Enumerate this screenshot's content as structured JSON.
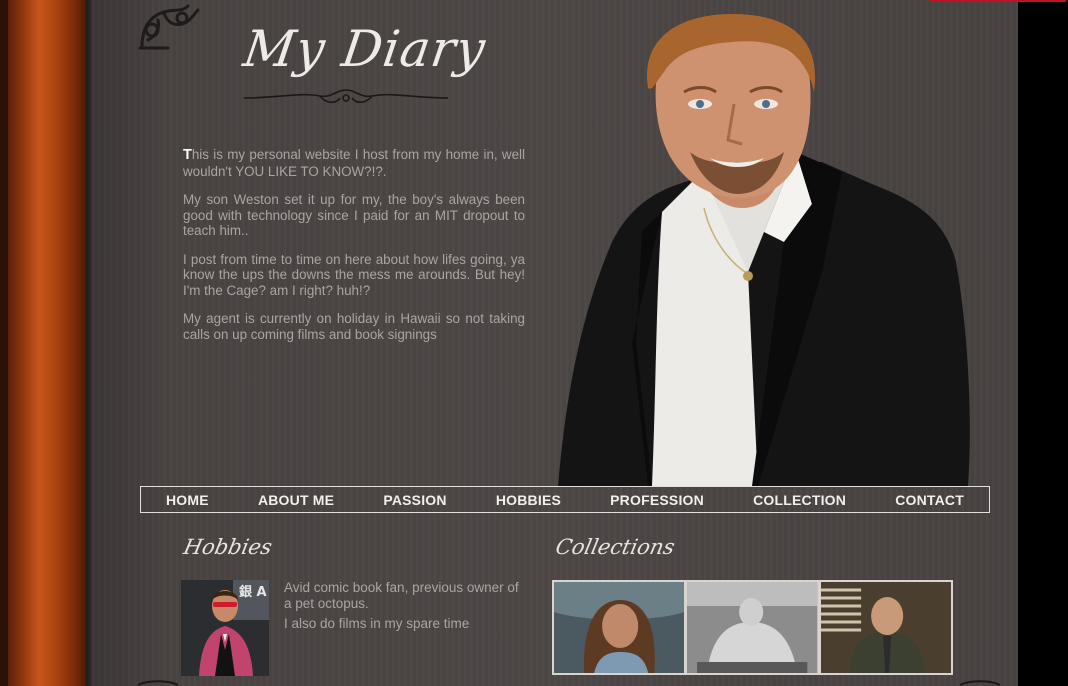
{
  "site": {
    "title": "My Diary"
  },
  "intro": {
    "first_letter": "T",
    "p1_rest": "his is my personal website I host from my home in, well wouldn't YOU LIKE TO KNOW?!?.",
    "p2": "My son Weston set it up for my, the boy's always been good with technology since I paid for an MIT dropout to teach him..",
    "p3": "I post from time to time on here about how lifes going, ya know the ups the downs the mess me arounds. But hey! I'm the Cage? am I right? huh!?",
    "p4": "My agent is currently on holiday in Hawaii so not taking calls on up coming films and book signings"
  },
  "nav": {
    "items": [
      "HOME",
      "ABOUT ME",
      "PASSION",
      "HOBBIES",
      "PROFESSION",
      "COLLECTION",
      "CONTACT"
    ]
  },
  "hobbies": {
    "title": "Hobbies",
    "text1": "Avid comic book fan, previous owner of a pet octopus.",
    "text2": "I also do films in my spare time",
    "thumb_caption": "銀 A NEW"
  },
  "collections": {
    "title": "Collections"
  },
  "colors": {
    "spine": "#a9430f",
    "page": "#4a4443",
    "text_muted": "#aaa5a2",
    "nav_border": "#e4e0dd",
    "accent_red": "#c1121f"
  }
}
